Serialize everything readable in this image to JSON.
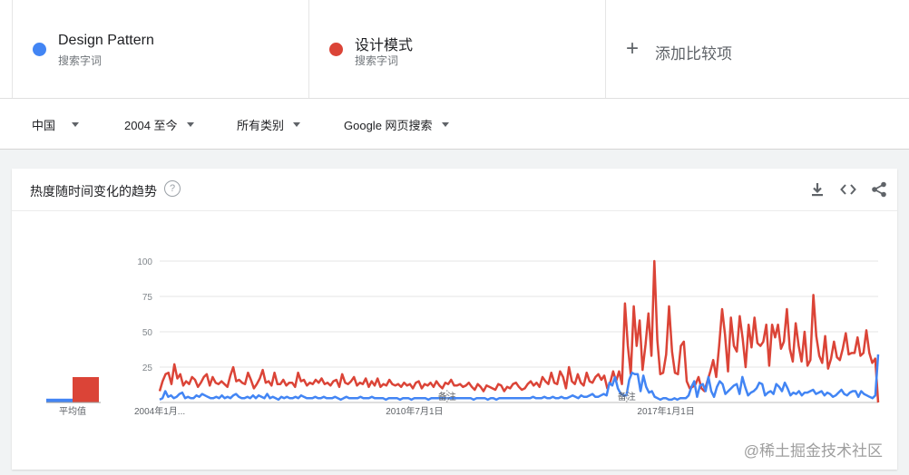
{
  "terms": [
    {
      "name": "Design Pattern",
      "sub": "搜索字词",
      "color": "#4285f4"
    },
    {
      "name": "设计模式",
      "sub": "搜索字词",
      "color": "#db4437"
    }
  ],
  "add_compare": {
    "icon": "plus-icon",
    "label": "添加比较项"
  },
  "filters": {
    "region": "中国",
    "time": "2004 至今",
    "category": "所有类别",
    "search_type": "Google 网页搜索"
  },
  "card": {
    "title": "热度随时间变化的趋势",
    "help_glyph": "?",
    "actions": [
      "download-icon",
      "embed-code-icon",
      "share-icon"
    ]
  },
  "chart_data": {
    "type": "line",
    "ylim": [
      0,
      100
    ],
    "yticks": [
      "100",
      "75",
      "50",
      "25"
    ],
    "xticks": [
      {
        "label": "2004年1月...",
        "at": 0
      },
      {
        "label": "2010年7月1日",
        "at": 0.35
      },
      {
        "label": "2017年1月1日",
        "at": 0.7
      }
    ],
    "notes": [
      {
        "label": "备注",
        "at": 0.4
      },
      {
        "label": "备注",
        "at": 0.65
      }
    ],
    "average_label": "平均值",
    "averages": [
      {
        "series": "Design Pattern",
        "value": 3
      },
      {
        "series": "设计模式",
        "value": 20
      }
    ],
    "series": [
      {
        "name": "设计模式",
        "color": "#db4437",
        "values": [
          8,
          15,
          20,
          21,
          13,
          27,
          17,
          20,
          12,
          15,
          13,
          18,
          16,
          11,
          14,
          18,
          20,
          12,
          18,
          14,
          13,
          15,
          13,
          11,
          19,
          25,
          15,
          16,
          14,
          13,
          21,
          16,
          10,
          13,
          17,
          23,
          14,
          15,
          12,
          21,
          13,
          13,
          16,
          12,
          14,
          14,
          11,
          21,
          15,
          16,
          12,
          14,
          13,
          16,
          14,
          17,
          13,
          14,
          12,
          15,
          16,
          11,
          20,
          14,
          13,
          15,
          18,
          12,
          14,
          13,
          17,
          11,
          15,
          12,
          17,
          11,
          13,
          12,
          16,
          13,
          12,
          13,
          11,
          14,
          12,
          13,
          10,
          14,
          15,
          10,
          13,
          12,
          14,
          11,
          15,
          12,
          10,
          14,
          13,
          16,
          12,
          12,
          13,
          11,
          12,
          14,
          11,
          9,
          13,
          11,
          8,
          12,
          11,
          10,
          9,
          13,
          12,
          8,
          11,
          10,
          13,
          14,
          11,
          9,
          10,
          13,
          15,
          12,
          14,
          11,
          18,
          15,
          13,
          21,
          14,
          13,
          22,
          18,
          10,
          25,
          15,
          13,
          20,
          14,
          12,
          21,
          15,
          14,
          18,
          20,
          16,
          19,
          10,
          14,
          22,
          15,
          22,
          13,
          70,
          40,
          20,
          68,
          40,
          58,
          23,
          41,
          63,
          33,
          100,
          44,
          20,
          21,
          34,
          68,
          36,
          21,
          20,
          40,
          43,
          15,
          10,
          11,
          13,
          18,
          10,
          8,
          15,
          22,
          30,
          18,
          40,
          66,
          48,
          22,
          60,
          40,
          36,
          61,
          45,
          25,
          55,
          39,
          60,
          42,
          40,
          43,
          55,
          26,
          55,
          46,
          55,
          38,
          43,
          66,
          38,
          29,
          56,
          40,
          29,
          50,
          26,
          30,
          76,
          47,
          33,
          28,
          47,
          24,
          31,
          43,
          32,
          30,
          38,
          49,
          34,
          35,
          35,
          46,
          33,
          35,
          51,
          35,
          28,
          31,
          0
        ]
      },
      {
        "name": "Design Pattern",
        "color": "#4285f4",
        "values": [
          2,
          3,
          8,
          4,
          5,
          3,
          4,
          6,
          7,
          3,
          4,
          3,
          3,
          5,
          4,
          6,
          5,
          4,
          3,
          3,
          4,
          3,
          5,
          3,
          4,
          3,
          5,
          6,
          4,
          3,
          3,
          4,
          3,
          5,
          3,
          5,
          4,
          3,
          6,
          3,
          4,
          3,
          2,
          4,
          3,
          4,
          3,
          3,
          4,
          3,
          5,
          4,
          3,
          3,
          3,
          4,
          3,
          3,
          4,
          3,
          3,
          3,
          4,
          3,
          2,
          3,
          4,
          3,
          3,
          3,
          3,
          4,
          3,
          3,
          3,
          4,
          3,
          3,
          3,
          3,
          2,
          3,
          3,
          3,
          3,
          2,
          3,
          3,
          3,
          2,
          3,
          3,
          3,
          3,
          3,
          2,
          3,
          3,
          3,
          3,
          3,
          3,
          3,
          3,
          3,
          3,
          3,
          3,
          3,
          3,
          3,
          2,
          3,
          3,
          3,
          3,
          2,
          3,
          3,
          2,
          3,
          3,
          3,
          3,
          3,
          3,
          3,
          3,
          3,
          3,
          3,
          3,
          4,
          3,
          3,
          3,
          4,
          3,
          3,
          4,
          3,
          3,
          4,
          3,
          3,
          4,
          5,
          4,
          3,
          5,
          4,
          4,
          5,
          6,
          4,
          4,
          5,
          6,
          5,
          14,
          12,
          18,
          10,
          6,
          5,
          5,
          16,
          21,
          20,
          20,
          8,
          19,
          11,
          7,
          8,
          4,
          3,
          2,
          3,
          3,
          2,
          2,
          3,
          2,
          3,
          3,
          3,
          5,
          11,
          15,
          4,
          12,
          13,
          8,
          18,
          8,
          4,
          11,
          15,
          13,
          6,
          8,
          10,
          12,
          13,
          6,
          18,
          11,
          5,
          7,
          8,
          10,
          14,
          13,
          5,
          7,
          8,
          6,
          13,
          11,
          8,
          14,
          10,
          5,
          7,
          6,
          8,
          5,
          7,
          7,
          8,
          9,
          6,
          7,
          8,
          5,
          7,
          6,
          4,
          5,
          7,
          9,
          6,
          5,
          7,
          8,
          8,
          4,
          8,
          6,
          5,
          4,
          3,
          5,
          34
        ]
      }
    ]
  },
  "watermark": "@稀土掘金技术社区"
}
